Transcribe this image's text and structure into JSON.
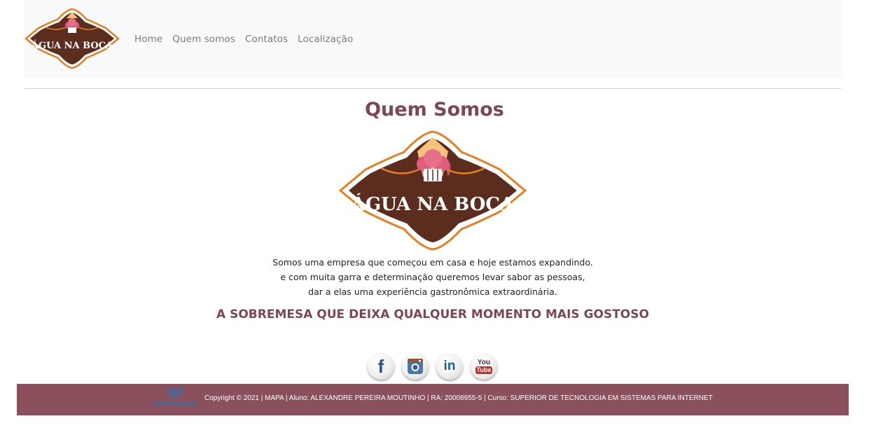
{
  "brand": {
    "name": "ÁGUA NA BOCA",
    "colors": {
      "brown": "#5a2d1e",
      "orange": "#e67e22",
      "pink": "#e05c7c",
      "accent": "#7b4656",
      "footer": "#8a505c"
    }
  },
  "nav": {
    "items": [
      {
        "label": "Home"
      },
      {
        "label": "Quem somos"
      },
      {
        "label": "Contatos"
      },
      {
        "label": "Localização"
      }
    ]
  },
  "main": {
    "title": "Quem Somos",
    "description": [
      "Somos uma empresa que começou em casa e hoje estamos expandindo.",
      "e com muita garra e determinação queremos levar sabor as pessoas,",
      "dar a elas uma experiência gastronômica extraordinária."
    ],
    "slogan": "A SOBREMESA QUE DEIXA QUALQUER MOMENTO MAIS GOSTOSO"
  },
  "social": {
    "icons": [
      "facebook-icon",
      "instagram-icon",
      "linkedin-icon",
      "youtube-icon"
    ],
    "facebook_glyph": "f",
    "linkedin_glyph": "in",
    "youtube_top": "You",
    "youtube_bottom": "Tube"
  },
  "footer": {
    "logo_text": "UniCesumar",
    "copyright": "Copyright © 2021 | MAPA | Aluno: ALEXANDRE PEREIRA MOUTINHO | RA: 20008955-5 | Curso: SUPERIOR DE TECNOLOGIA EM SISTEMAS PARA INTERNET"
  }
}
